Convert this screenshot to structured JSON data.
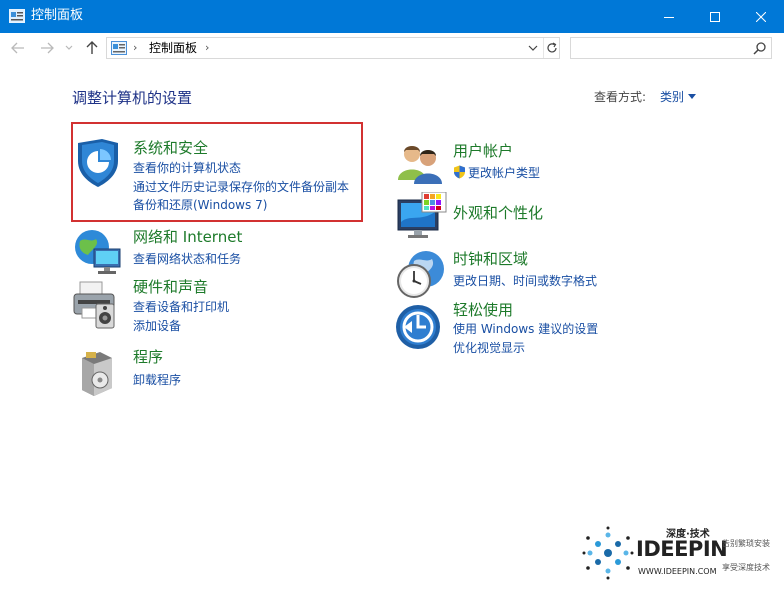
{
  "window": {
    "title": "控制面板"
  },
  "address": {
    "crumb": "控制面板",
    "search_placeholder": ""
  },
  "main": {
    "heading": "调整计算机的设置",
    "view_by_label": "查看方式:",
    "view_by_value": "类别"
  },
  "categories": {
    "security": {
      "title": "系统和安全",
      "links": [
        "查看你的计算机状态",
        "通过文件历史记录保存你的文件备份副本",
        "备份和还原(Windows 7)"
      ]
    },
    "network": {
      "title": "网络和 Internet",
      "links": [
        "查看网络状态和任务"
      ]
    },
    "hardware": {
      "title": "硬件和声音",
      "links": [
        "查看设备和打印机",
        "添加设备"
      ]
    },
    "programs": {
      "title": "程序",
      "links": [
        "卸载程序"
      ]
    },
    "user": {
      "title": "用户帐户",
      "links": [
        "更改帐户类型"
      ]
    },
    "appearance": {
      "title": "外观和个性化",
      "links": []
    },
    "clock": {
      "title": "时钟和区域",
      "links": [
        "更改日期、时间或数字格式"
      ]
    },
    "ease": {
      "title": "轻松使用",
      "links": [
        "使用 Windows 建议的设置",
        "优化视觉显示"
      ]
    }
  },
  "watermark": {
    "top": "深度·技术",
    "brand": "IDEEPIN",
    "url": "WWW.IDEEPIN.COM",
    "tag1": "告别繁琐安装",
    "tag2": "享受深度技术"
  },
  "colors": {
    "titlebar": "#0078d7",
    "category_title": "#1d7a2a",
    "link": "#1a4fa3",
    "heading": "#1e3287",
    "highlight": "#d23131"
  },
  "icons": {
    "app": "control-panel-icon",
    "minimize": "minimize-icon",
    "maximize": "maximize-icon",
    "close": "close-icon",
    "back": "arrow-left-icon",
    "forward": "arrow-right-icon",
    "up": "arrow-up-icon",
    "refresh": "refresh-icon",
    "search": "search-icon",
    "uac_shield": "shield-icon"
  }
}
